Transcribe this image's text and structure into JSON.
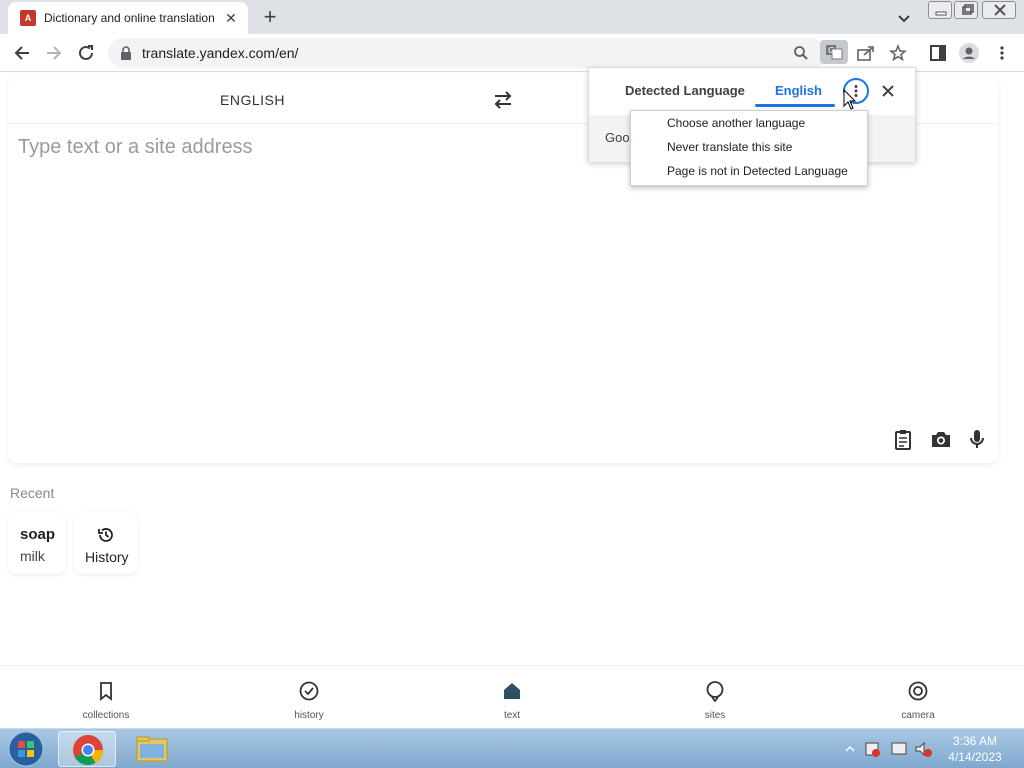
{
  "browser": {
    "tab": {
      "title": "Dictionary and online translation"
    },
    "address": {
      "url": "translate.yandex.com/en/"
    },
    "icons": [
      "back-icon",
      "forward-icon",
      "reload-icon",
      "lock-icon",
      "search-icon",
      "translate-icon",
      "share-icon",
      "star-icon",
      "sidepanel-icon",
      "profile-icon",
      "menu-icon"
    ]
  },
  "translator": {
    "source_language": "ENGLISH",
    "input_placeholder": "Type text or a site address",
    "recent_title": "Recent",
    "recent_words": [
      "soap",
      "milk"
    ],
    "history_label": "History"
  },
  "bottom_nav": {
    "items": [
      {
        "label": "collections",
        "icon": "bookmark-icon"
      },
      {
        "label": "history",
        "icon": "check-circle-icon"
      },
      {
        "label": "text",
        "icon": "home-icon"
      },
      {
        "label": "sites",
        "icon": "globe-icon"
      },
      {
        "label": "camera",
        "icon": "camera-icon"
      }
    ],
    "active": "text"
  },
  "translate_popup": {
    "tab_detected": "Detected Language",
    "tab_target": "English",
    "footer_text": "Goo",
    "menu": [
      "Choose another language",
      "Never translate this site",
      "Page is not in Detected Language"
    ]
  },
  "taskbar": {
    "time": "3:36 AM",
    "date": "4/14/2023"
  },
  "colors": {
    "accent": "#1a73e8",
    "taskbar": "#8fb4d9"
  }
}
